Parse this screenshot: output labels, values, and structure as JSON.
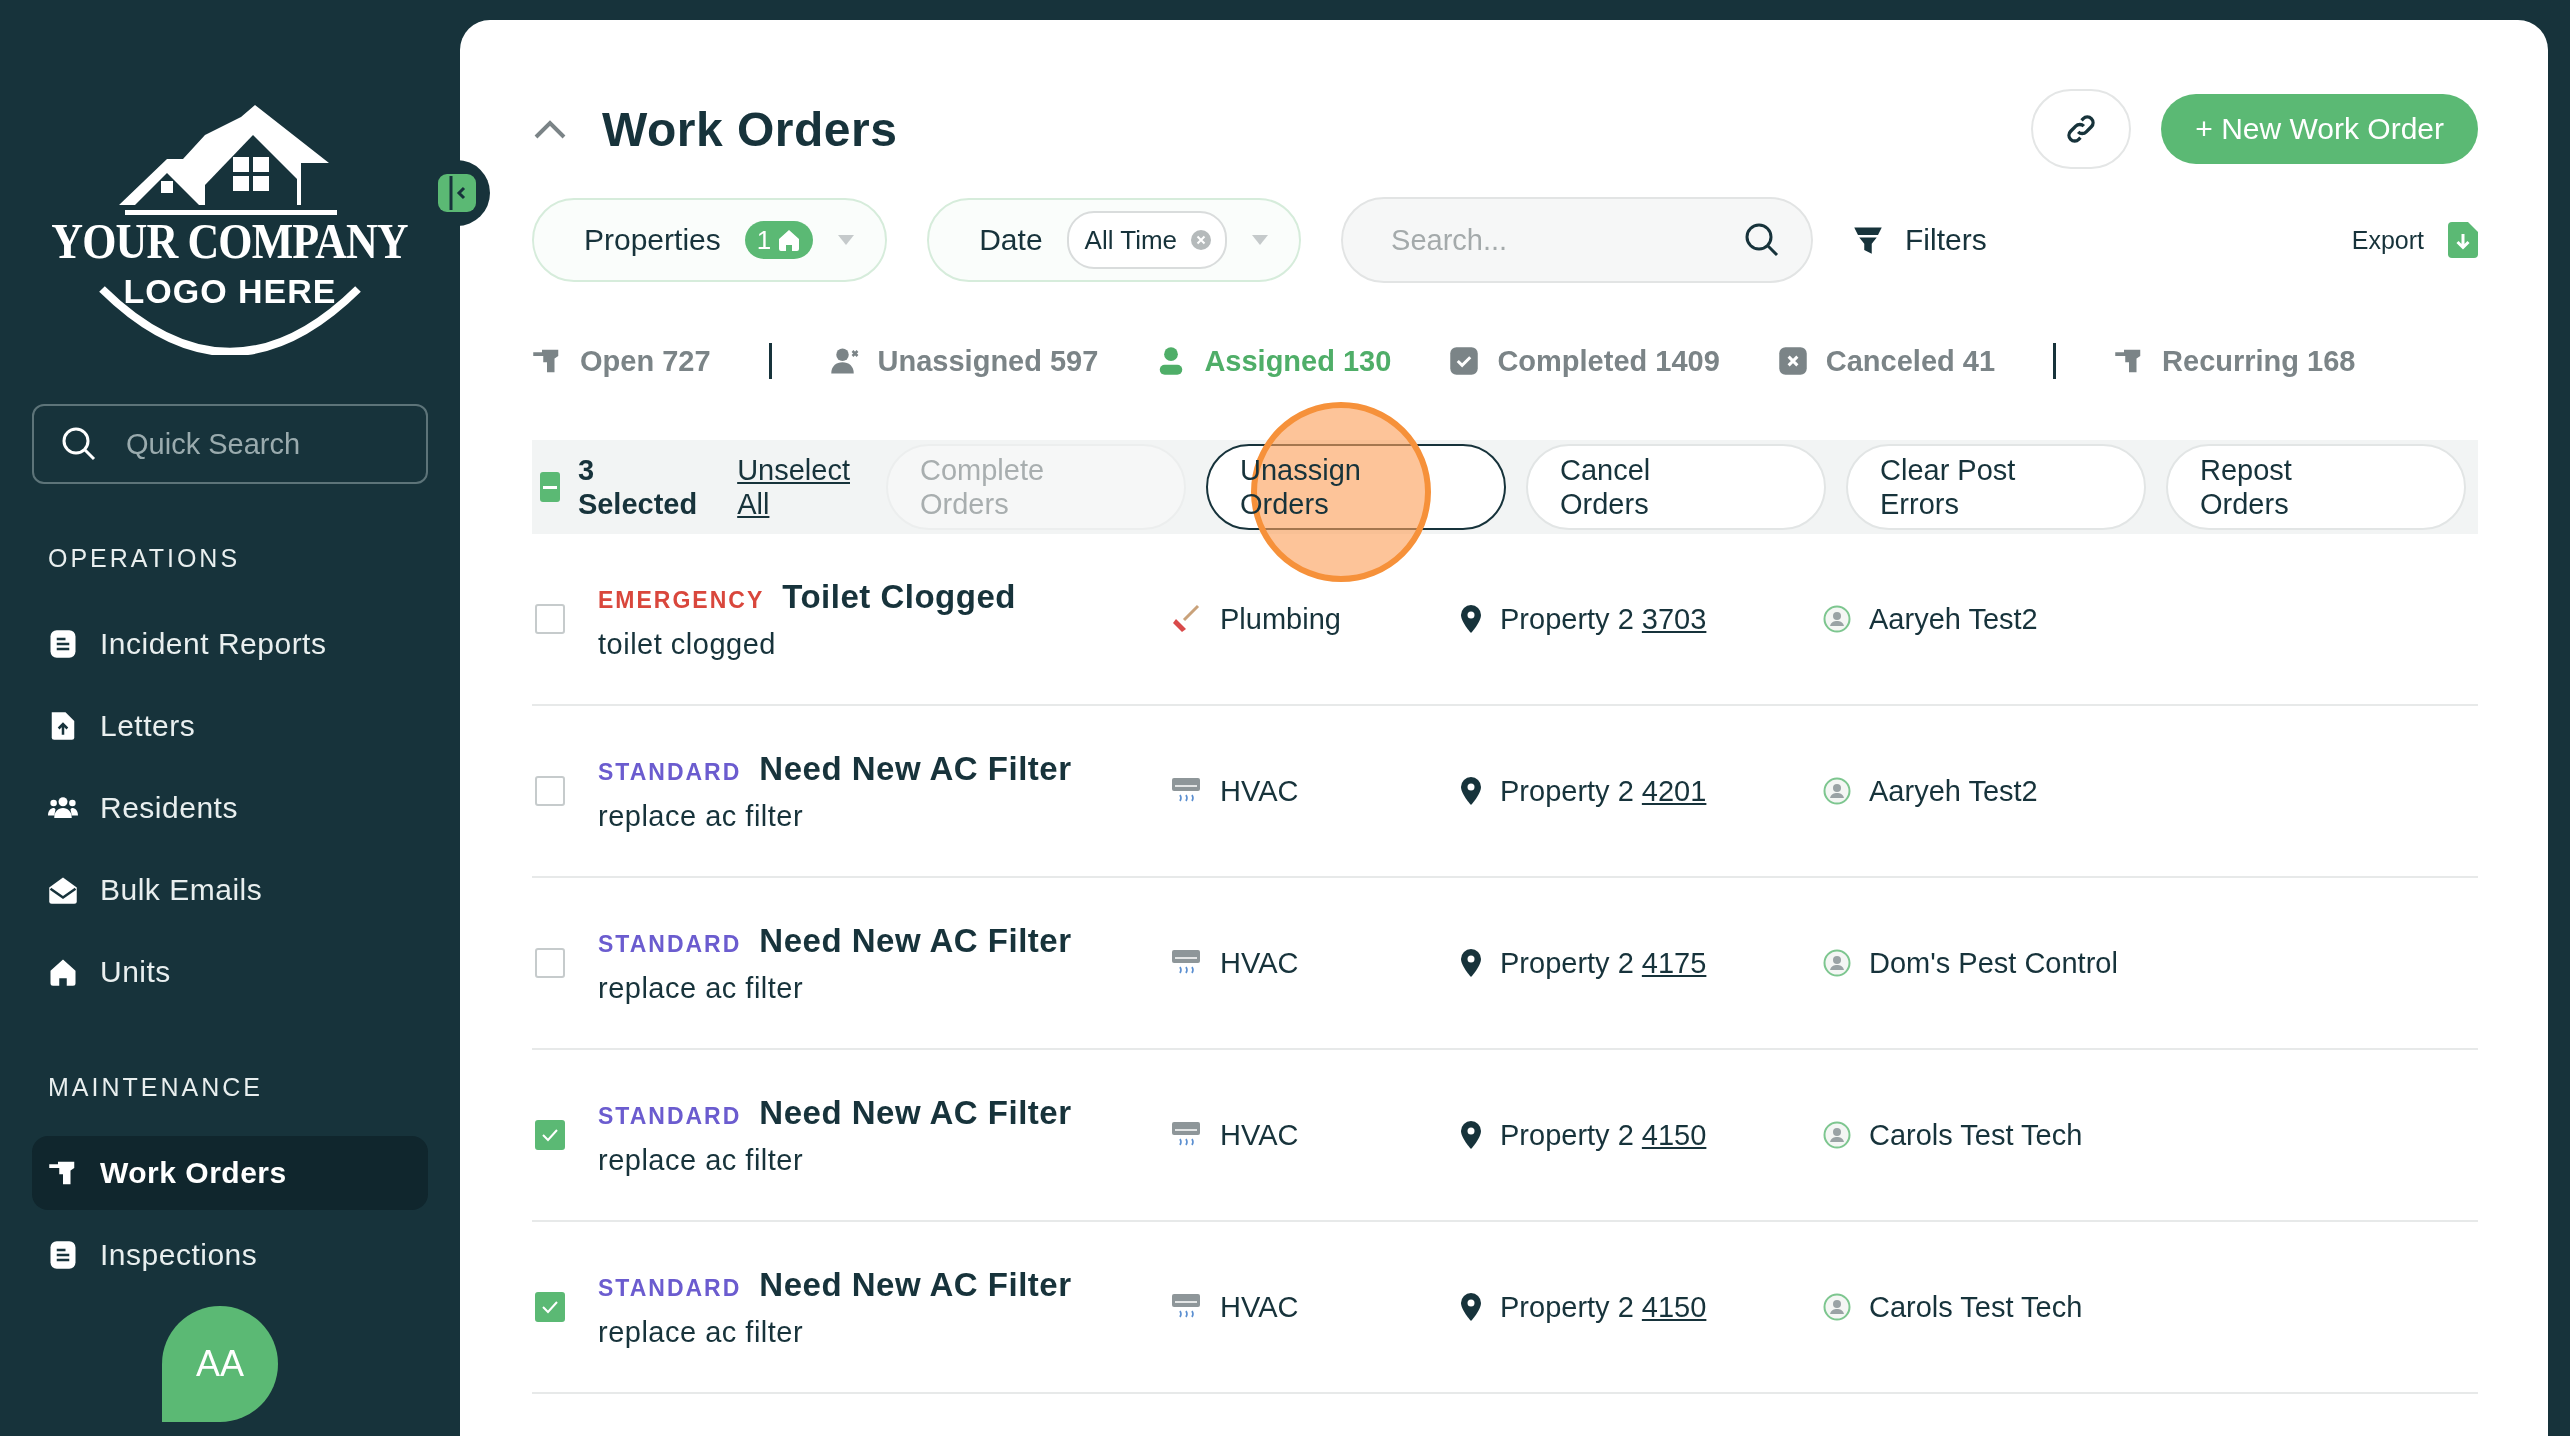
{
  "sidebar": {
    "logo": {
      "line1": "YOUR COMPANY",
      "line2": "LOGO HERE"
    },
    "search": {
      "placeholder": "Quick Search"
    },
    "sections": [
      {
        "title": "OPERATIONS",
        "items": [
          {
            "label": "Incident Reports",
            "selected": false
          },
          {
            "label": "Letters",
            "selected": false
          },
          {
            "label": "Residents",
            "selected": false
          },
          {
            "label": "Bulk Emails",
            "selected": false
          },
          {
            "label": "Units",
            "selected": false
          }
        ]
      },
      {
        "title": "MAINTENANCE",
        "items": [
          {
            "label": "Work Orders",
            "selected": true
          },
          {
            "label": "Inspections",
            "selected": false
          }
        ]
      }
    ],
    "avatar": {
      "initials": "AA"
    }
  },
  "header": {
    "title": "Work Orders",
    "new_button": "+ New Work Order"
  },
  "filters": {
    "properties": {
      "label": "Properties",
      "count": "1"
    },
    "date": {
      "label": "Date",
      "value": "All Time"
    },
    "search": {
      "placeholder": "Search..."
    },
    "filters_label": "Filters",
    "export_label": "Export"
  },
  "status_tabs": [
    {
      "kind": "tab",
      "label": "Open 727",
      "selected": false
    },
    {
      "kind": "divider"
    },
    {
      "kind": "tab",
      "label": "Unassigned 597",
      "selected": false
    },
    {
      "kind": "tab",
      "label": "Assigned 130",
      "selected": true
    },
    {
      "kind": "tab",
      "label": "Completed 1409",
      "selected": false
    },
    {
      "kind": "tab",
      "label": "Canceled 41",
      "selected": false
    },
    {
      "kind": "divider"
    },
    {
      "kind": "tab",
      "label": "Recurring 168",
      "selected": false
    }
  ],
  "bulk_bar": {
    "partial": true,
    "selected_text": "3 Selected",
    "unselect_link": "Unselect All",
    "actions": [
      {
        "label": "Complete Orders",
        "disabled": true,
        "focused": false,
        "clicked": false
      },
      {
        "label": "Unassign Orders",
        "disabled": false,
        "focused": true,
        "clicked": true
      },
      {
        "label": "Cancel Orders",
        "disabled": false,
        "focused": false,
        "clicked": false
      },
      {
        "label": "Clear Post Errors",
        "disabled": false,
        "focused": false,
        "clicked": false
      },
      {
        "label": "Repost Orders",
        "disabled": false,
        "focused": false,
        "clicked": false
      }
    ]
  },
  "rows": [
    {
      "kind": "plumbing",
      "checked": false,
      "priority": "EMERGENCY",
      "color": "#d9473c",
      "title": "Toilet Clogged",
      "description": "toilet clogged",
      "category": "Plumbing",
      "property": "Property 2",
      "unit": "3703",
      "assignee": "Aaryeh Test2"
    },
    {
      "kind": "hvac",
      "checked": false,
      "priority": "STANDARD",
      "color": "#6b5ccf",
      "title": "Need New AC Filter",
      "description": "replace ac filter",
      "category": "HVAC",
      "property": "Property 2",
      "unit": "4201",
      "assignee": "Aaryeh Test2"
    },
    {
      "kind": "hvac",
      "checked": false,
      "priority": "STANDARD",
      "color": "#6b5ccf",
      "title": "Need New AC Filter",
      "description": "replace ac filter",
      "category": "HVAC",
      "property": "Property 2",
      "unit": "4175",
      "assignee": "Dom's Pest Control"
    },
    {
      "kind": "hvac",
      "checked": true,
      "priority": "STANDARD",
      "color": "#6b5ccf",
      "title": "Need New AC Filter",
      "description": "replace ac filter",
      "category": "HVAC",
      "property": "Property 2",
      "unit": "4150",
      "assignee": "Carols Test Tech"
    },
    {
      "kind": "hvac",
      "checked": true,
      "priority": "STANDARD",
      "color": "#6b5ccf",
      "title": "Need New AC Filter",
      "description": "replace ac filter",
      "category": "HVAC",
      "property": "Property 2",
      "unit": "4150",
      "assignee": "Carols Test Tech"
    }
  ]
}
